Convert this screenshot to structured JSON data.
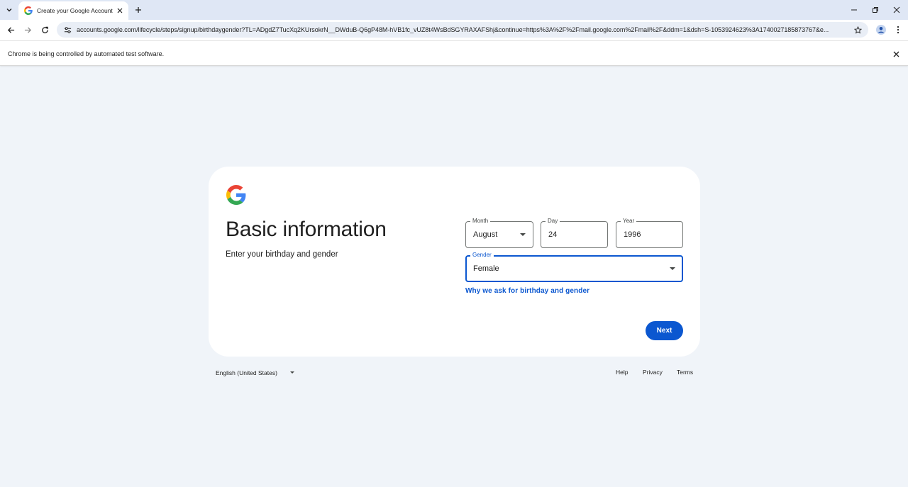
{
  "browser": {
    "tab": {
      "title": "Create your Google Account"
    },
    "url": "accounts.google.com/lifecycle/steps/signup/birthdaygender?TL=ADgdZ7TucXq2KUrsokrN__DWduB-Q6gP48M-hVB1fc_vUZ8t4WsBdSGYRAXAFShj&continue=https%3A%2F%2Fmail.google.com%2Fmail%2F&ddm=1&dsh=S-1053924623%3A1740027185873767&e...",
    "infobar_text": "Chrome is being controlled by automated test software."
  },
  "card": {
    "title": "Basic information",
    "subtitle": "Enter your birthday and gender",
    "month": {
      "label": "Month",
      "value": "August"
    },
    "day": {
      "label": "Day",
      "value": "24"
    },
    "year": {
      "label": "Year",
      "value": "1996"
    },
    "gender": {
      "label": "Gender",
      "value": "Female"
    },
    "why_link": "Why we ask for birthday and gender",
    "next_label": "Next"
  },
  "footer": {
    "language": "English (United States)",
    "links": [
      "Help",
      "Privacy",
      "Terms"
    ]
  },
  "colors": {
    "accent": "#0b57d0",
    "page_background": "#f0f4f9",
    "tabstrip": "#dfe7f5"
  }
}
